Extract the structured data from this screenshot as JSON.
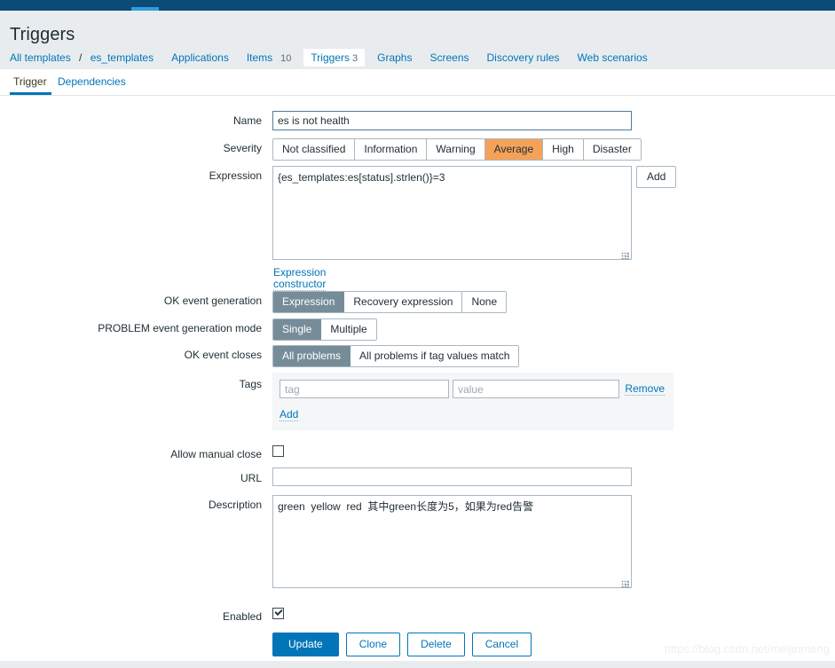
{
  "window": {
    "page_title": "Triggers",
    "accent_color": "#2e9ddb",
    "topbar_color": "#0c4b75"
  },
  "breadcrumb": {
    "all_templates": "All templates",
    "separator": "/",
    "template_name": "es_templates",
    "items": [
      {
        "label": "Applications",
        "count": ""
      },
      {
        "label": "Items",
        "count": "10"
      },
      {
        "label": "Triggers",
        "count": "3",
        "selected": true
      },
      {
        "label": "Graphs",
        "count": ""
      },
      {
        "label": "Screens",
        "count": ""
      },
      {
        "label": "Discovery rules",
        "count": ""
      },
      {
        "label": "Web scenarios",
        "count": ""
      }
    ]
  },
  "tabs": [
    {
      "label": "Trigger",
      "active": true
    },
    {
      "label": "Dependencies",
      "active": false
    }
  ],
  "form": {
    "name": {
      "label": "Name",
      "value": "es is not health",
      "placeholder": ""
    },
    "severity": {
      "label": "Severity",
      "options": [
        "Not classified",
        "Information",
        "Warning",
        "Average",
        "High",
        "Disaster"
      ],
      "selected": "Average",
      "selected_color": "#f5a259"
    },
    "expression": {
      "label": "Expression",
      "value": "{es_templates:es[status].strlen()}=3",
      "add_button": "Add",
      "constructor_link": "Expression constructor"
    },
    "ok_event_generation": {
      "label": "OK event generation",
      "options": [
        "Expression",
        "Recovery expression",
        "None"
      ],
      "selected": "Expression"
    },
    "problem_event_generation_mode": {
      "label": "PROBLEM event generation mode",
      "options": [
        "Single",
        "Multiple"
      ],
      "selected": "Single"
    },
    "ok_event_closes": {
      "label": "OK event closes",
      "options": [
        "All problems",
        "All problems if tag values match"
      ],
      "selected": "All problems"
    },
    "tags": {
      "label": "Tags",
      "rows": [
        {
          "tag_value": "",
          "tag_placeholder": "tag",
          "value_value": "",
          "value_placeholder": "value",
          "remove_label": "Remove"
        }
      ],
      "add_label": "Add"
    },
    "allow_manual_close": {
      "label": "Allow manual close",
      "checked": false
    },
    "url": {
      "label": "URL",
      "value": "",
      "placeholder": ""
    },
    "description": {
      "label": "Description",
      "value": "green  yellow  red  其中green长度为5，如果为red告警"
    },
    "enabled": {
      "label": "Enabled",
      "checked": true
    }
  },
  "footer_buttons": {
    "update": "Update",
    "clone": "Clone",
    "delete": "Delete",
    "cancel": "Cancel",
    "primary_color": "#0275b8"
  },
  "watermark": "https://blog.csdn.net/meijinmeng"
}
